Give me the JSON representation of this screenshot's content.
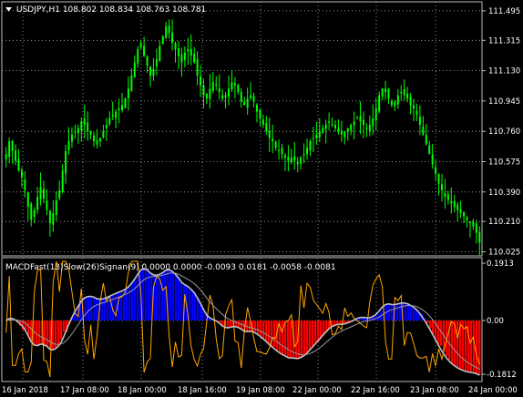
{
  "main_chart": {
    "symbol_line": "USDJPY,H1  108.802 108.834 108.763 108.781",
    "price_ticks": [
      "111.495",
      "111.315",
      "111.130",
      "110.945",
      "110.760",
      "110.575",
      "110.390",
      "110.210",
      "110.025"
    ],
    "colors": {
      "candle_up": "#00ff00",
      "candle_down": "#00ff00",
      "grid": "#b0b0b0",
      "background": "#000000"
    }
  },
  "indicator": {
    "label": "MACDFast(13)Slow(26)Signan(9) 0.0000 0.0000 -0.0093 0.0181 -0.0058 -0.0081",
    "value_ticks": [
      "0.1913",
      "0.00",
      "-0.1812"
    ],
    "colors": {
      "hist_pos": "#0000ff",
      "hist_neg": "#ff0000",
      "fast": "#ffa500",
      "slow": "#c0c0c0"
    }
  },
  "time_axis": {
    "labels": [
      "16 Jan 2018",
      "17 Jan 08:00",
      "18 Jan 00:00",
      "18 Jan 16:00",
      "19 Jan 08:00",
      "22 Jan 00:00",
      "22 Jan 16:00",
      "23 Jan 08:00",
      "24 Jan 00:00"
    ]
  },
  "chart_data": {
    "type": "candlestick",
    "symbol": "USDJPY",
    "timeframe": "H1",
    "ohlc_last": {
      "open": 108.802,
      "high": 108.834,
      "low": 108.763,
      "close": 108.781
    },
    "ylim": [
      110.0,
      111.55
    ],
    "close_series": [
      110.62,
      110.7,
      110.64,
      110.58,
      110.52,
      110.48,
      110.4,
      110.3,
      110.22,
      110.28,
      110.36,
      110.42,
      110.35,
      110.28,
      110.2,
      110.26,
      110.34,
      110.4,
      110.52,
      110.64,
      110.7,
      110.74,
      110.76,
      110.78,
      110.82,
      110.8,
      110.76,
      110.74,
      110.7,
      110.68,
      110.72,
      110.76,
      110.8,
      110.84,
      110.86,
      110.88,
      110.9,
      110.92,
      110.96,
      111.02,
      111.1,
      111.18,
      111.26,
      111.3,
      111.22,
      111.16,
      111.1,
      111.14,
      111.2,
      111.28,
      111.34,
      111.4,
      111.36,
      111.3,
      111.26,
      111.22,
      111.18,
      111.24,
      111.26,
      111.22,
      111.18,
      111.1,
      111.04,
      110.98,
      110.96,
      111.02,
      111.06,
      111.04,
      111.0,
      110.96,
      110.98,
      111.02,
      111.06,
      111.04,
      111.0,
      110.94,
      110.92,
      110.96,
      110.98,
      110.94,
      110.88,
      110.84,
      110.8,
      110.76,
      110.72,
      110.7,
      110.66,
      110.64,
      110.62,
      110.6,
      110.58,
      110.6,
      110.58,
      110.56,
      110.6,
      110.62,
      110.66,
      110.7,
      110.72,
      110.74,
      110.76,
      110.78,
      110.8,
      110.82,
      110.8,
      110.78,
      110.76,
      110.74,
      110.76,
      110.78,
      110.8,
      110.82,
      110.84,
      110.82,
      110.8,
      110.78,
      110.8,
      110.84,
      110.9,
      110.98,
      111.02,
      111.0,
      110.96,
      110.92,
      110.94,
      110.98,
      111.0,
      110.98,
      110.96,
      110.92,
      110.9,
      110.86,
      110.8,
      110.74,
      110.68,
      110.62,
      110.56,
      110.5,
      110.44,
      110.4,
      110.36,
      110.34,
      110.32,
      110.3,
      110.28,
      110.26,
      110.24,
      110.22,
      110.2,
      110.18,
      110.14,
      110.08
    ],
    "macd": {
      "label": "MACDFast(13)Slow(26)Signan(9)",
      "values": [
        0.0,
        0.0,
        -0.0093,
        0.0181,
        -0.0058,
        -0.0081
      ],
      "ylim": [
        -0.1812,
        0.1913
      ]
    }
  }
}
